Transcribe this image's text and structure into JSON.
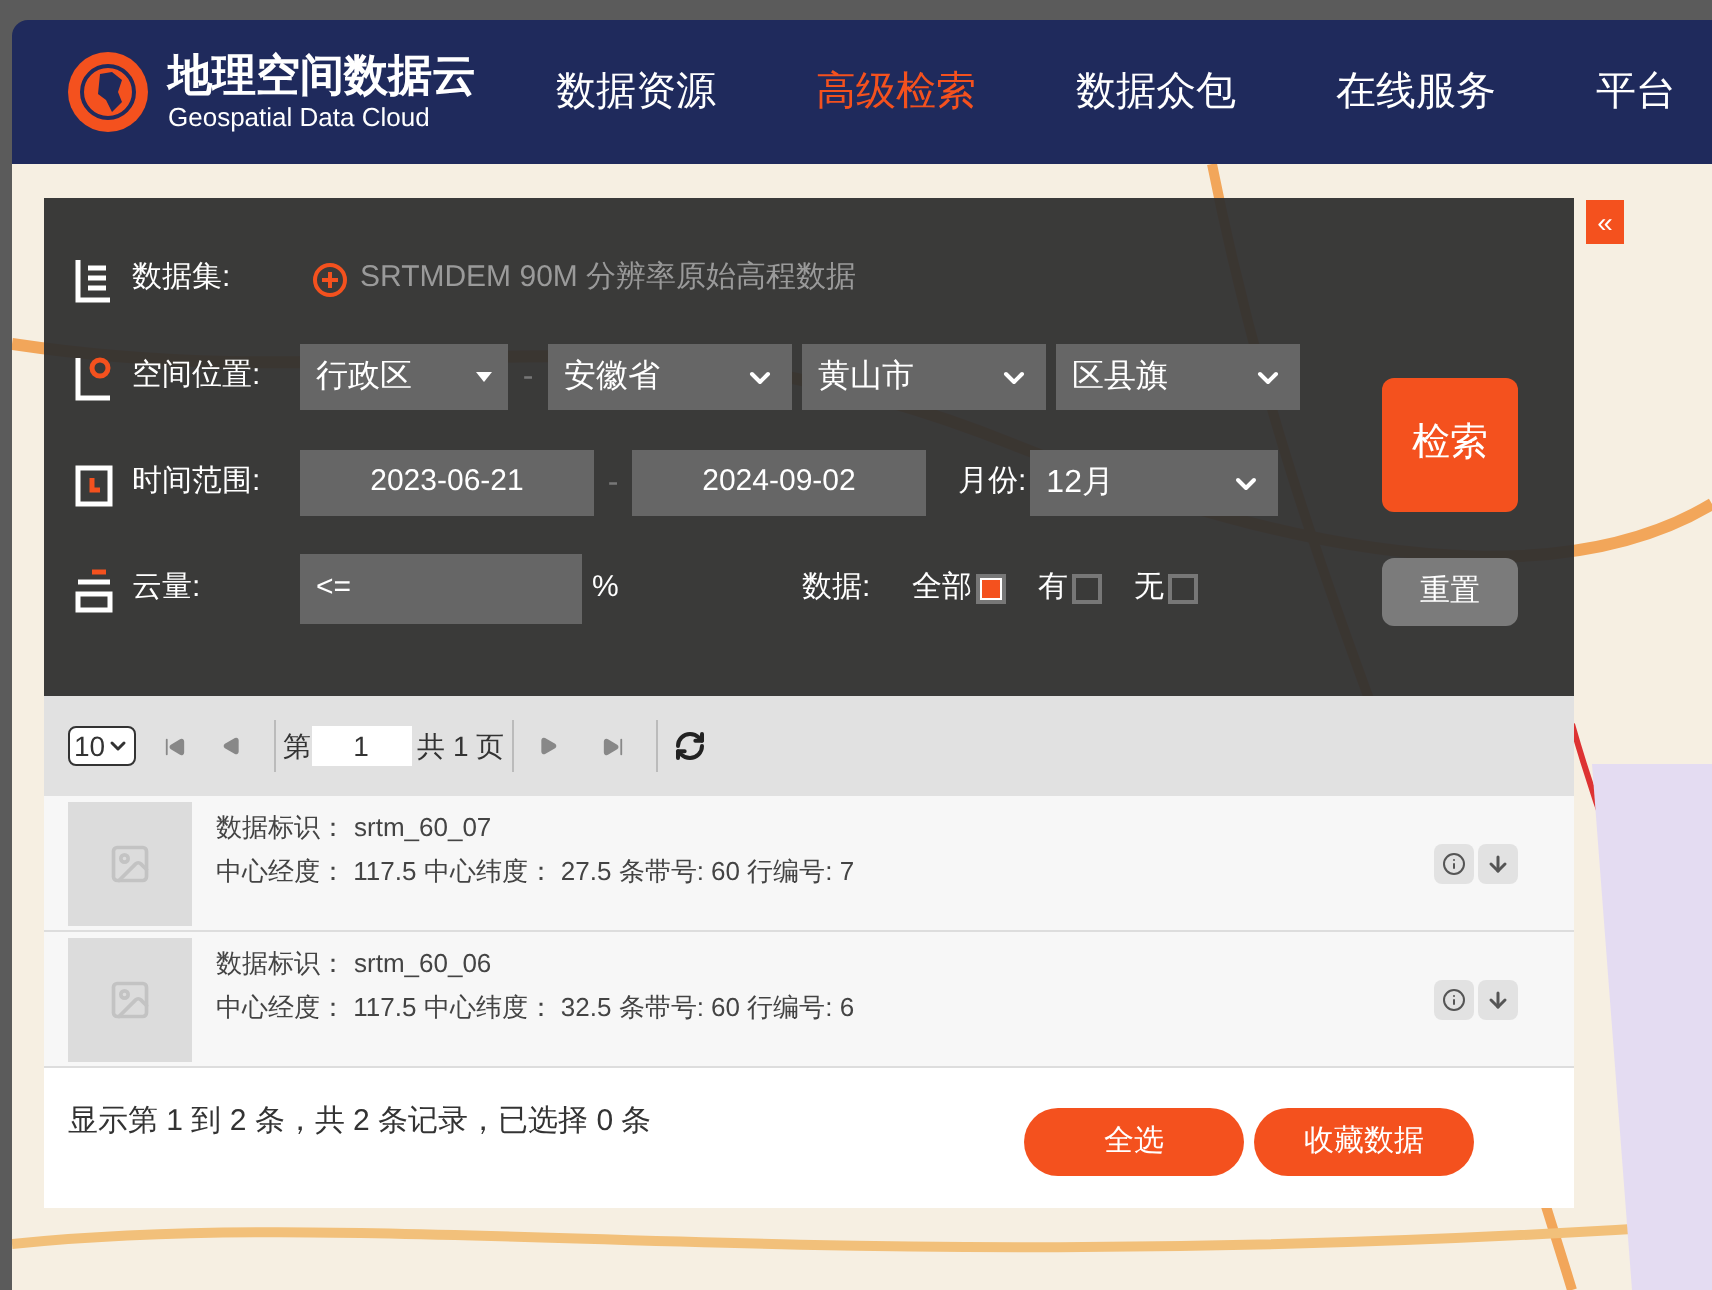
{
  "header": {
    "logo_title": "地理空间数据云",
    "logo_subtitle": "Geospatial Data Cloud",
    "nav": [
      {
        "label": "数据资源",
        "selected": false
      },
      {
        "label": "高级检索",
        "selected": true
      },
      {
        "label": "数据众包",
        "selected": false
      },
      {
        "label": "在线服务",
        "selected": false
      },
      {
        "label": "平台",
        "selected": false
      }
    ]
  },
  "collapse_button": "«",
  "search": {
    "dataset": {
      "label": "数据集:",
      "value": "SRTMDEM 90M 分辨率原始高程数据"
    },
    "location": {
      "label": "空间位置:",
      "selects": [
        "行政区",
        "安徽省",
        "黄山市",
        "区县旗"
      ],
      "separator": "-"
    },
    "time": {
      "label": "时间范围:",
      "start": "2023-06-21",
      "separator": "-",
      "end": "2024-09-02",
      "month_label": "月份:",
      "month": "12月"
    },
    "cloud": {
      "label": "云量:",
      "value": "<=",
      "unit": "%"
    },
    "data": {
      "label": "数据:",
      "options": [
        {
          "label": "全部",
          "checked": true
        },
        {
          "label": "有",
          "checked": false
        },
        {
          "label": "无",
          "checked": false
        }
      ]
    },
    "search_button": "检索",
    "reset_button": "重置"
  },
  "pager": {
    "page_size": "10",
    "page_prefix": "第",
    "page": "1",
    "page_suffix": "共 1 页"
  },
  "results": [
    {
      "id_label": "数据标识：",
      "id": "srtm_60_07",
      "details": "中心经度： 117.5 中心纬度： 27.5 条带号: 60 行编号: 7"
    },
    {
      "id_label": "数据标识：",
      "id": "srtm_60_06",
      "details": "中心经度： 117.5 中心纬度： 32.5 条带号: 60 行编号: 6"
    }
  ],
  "footer": {
    "summary": "显示第 1 到 2 条，共 2 条记录，已选择 0 条",
    "buttons": [
      "全选",
      "收藏数据"
    ]
  }
}
